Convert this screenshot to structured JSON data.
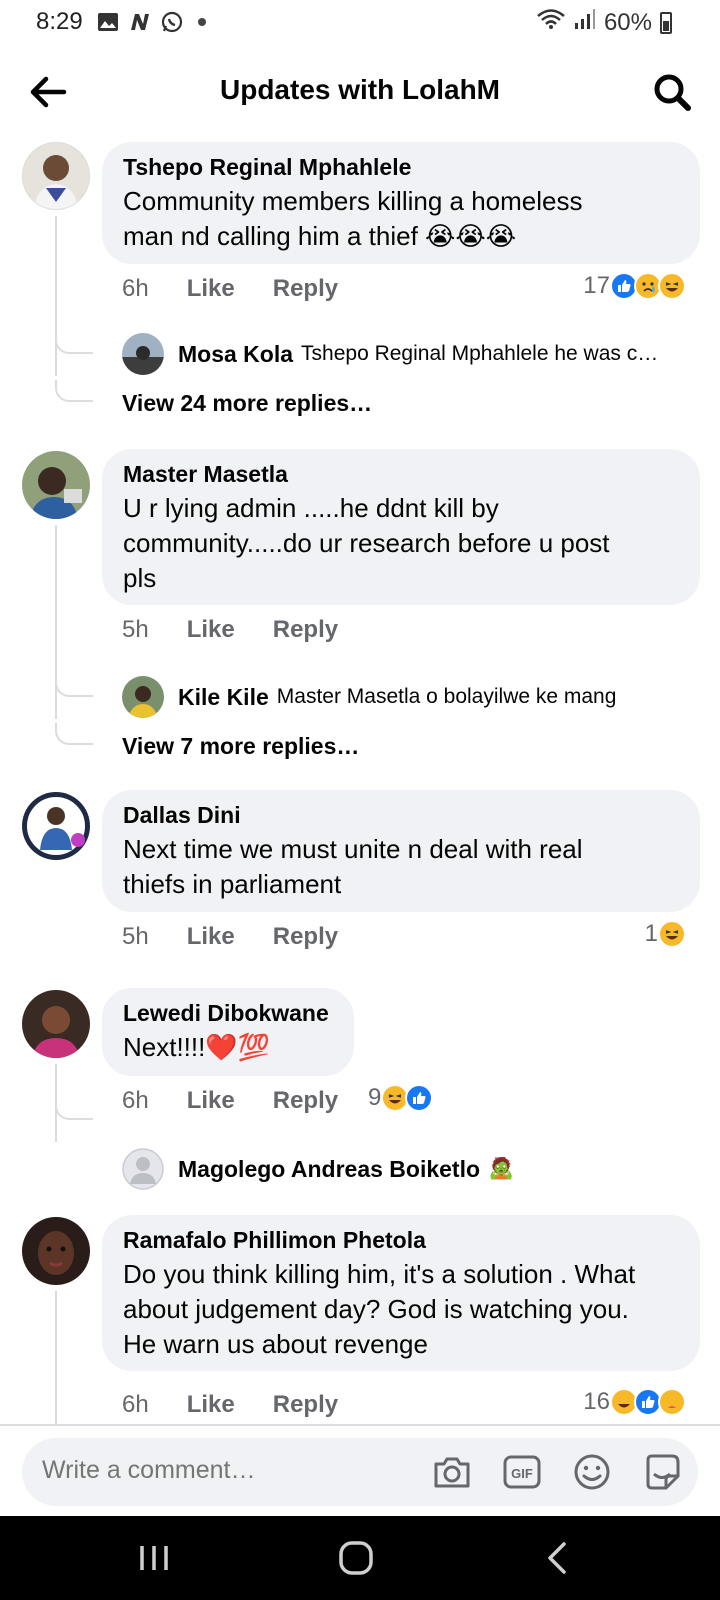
{
  "status_bar": {
    "time": "8:29",
    "battery": "60%",
    "icons_left": [
      "image-icon",
      "n-app-icon",
      "whatsapp-icon",
      "dot-icon"
    ],
    "icons_right": [
      "wifi-icon",
      "signal-icon",
      "battery-icon"
    ]
  },
  "header": {
    "title": "Updates with LolahM",
    "back_icon": "arrow-left-icon",
    "search_icon": "search-icon"
  },
  "comments": [
    {
      "author": "Tshepo Reginal Mphahlele",
      "text_lines": [
        "Community members killing a homeless",
        "man nd calling him a thief 😭😭😭"
      ],
      "time": "6h",
      "like": "Like",
      "reply": "Reply",
      "reaction_count": "17",
      "reactions": [
        "like",
        "sad",
        "haha"
      ],
      "reply_preview": {
        "author": "Mosa Kola",
        "text": "Tshepo Reginal Mphahlele he was c…"
      },
      "view_more": "View 24 more replies…"
    },
    {
      "author": "Master Masetla",
      "text_lines": [
        "U r lying admin .....he ddnt kill by",
        "community.....do ur research before u post",
        "pls"
      ],
      "time": "5h",
      "like": "Like",
      "reply": "Reply",
      "reply_preview": {
        "author": "Kile Kile",
        "text": "Master Masetla o bolayilwe ke mang"
      },
      "view_more": "View 7 more replies…"
    },
    {
      "author": "Dallas Dini",
      "text_lines": [
        "Next time we must  unite  n deal  with  real",
        "thiefs in parliament"
      ],
      "time": "5h",
      "like": "Like",
      "reply": "Reply",
      "reaction_count": "1",
      "reactions": [
        "haha"
      ]
    },
    {
      "author": "Lewedi Dibokwane",
      "text_lines": [
        "Next!!!!❤️💯"
      ],
      "time": "6h",
      "like": "Like",
      "reply": "Reply",
      "reaction_count": "9",
      "reactions": [
        "haha",
        "like"
      ],
      "reply_preview": {
        "author": "Magolego Andreas Boiketlo",
        "text": "🧟"
      }
    },
    {
      "author": "Ramafalo Phillimon Phetola",
      "text_lines": [
        "Do you think killing him, it's a solution . What",
        "about judgement day? God is watching you.",
        "He warn us about revenge"
      ],
      "time": "6h",
      "like": "Like",
      "reply": "Reply",
      "reaction_count": "16",
      "reactions": [
        "haha",
        "like",
        "care"
      ]
    }
  ],
  "composer": {
    "placeholder": "Write a comment…",
    "icons": [
      "camera-icon",
      "gif-icon",
      "emoji-icon",
      "sticker-icon"
    ]
  },
  "nav": {
    "icons": [
      "recent-apps-icon",
      "home-icon",
      "back-icon"
    ]
  },
  "colors": {
    "bubble": "#f0f2f5",
    "meta_text": "#65676b",
    "like_blue": "#1877f2",
    "haha_yellow": "#f7b928"
  }
}
